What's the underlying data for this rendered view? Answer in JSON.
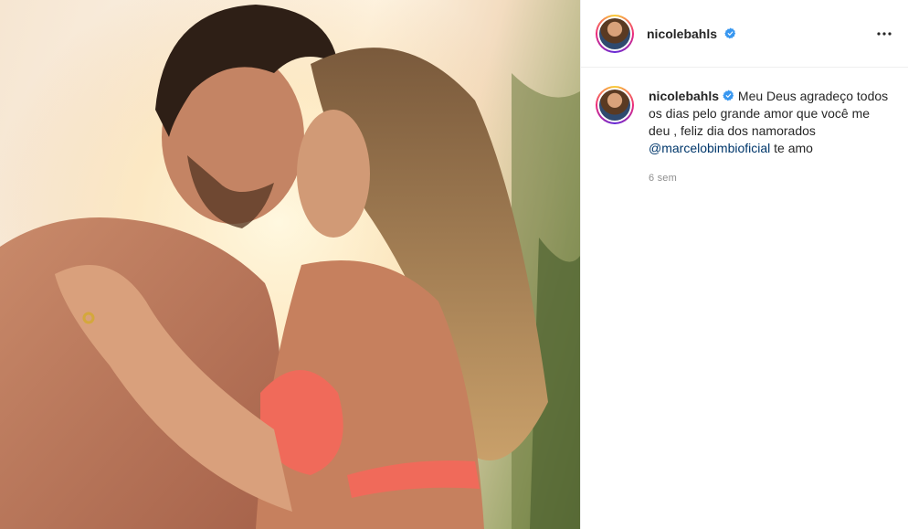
{
  "post": {
    "image_alt": "Couple embracing forehead to forehead at sunset",
    "author": {
      "username": "nicolebahls",
      "verified": true
    },
    "caption": {
      "text_before": "Meu Deus agradeço todos os dias pelo grande amor que você me deu , feliz dia dos namorados",
      "mention": "@marcelobimbioficial",
      "text_after": "te amo"
    },
    "timestamp": "6 sem"
  },
  "icons": {
    "more": "more-options-icon",
    "verified": "verified-badge-icon"
  },
  "colors": {
    "mention": "#00376b",
    "verified": "#3897f0",
    "muted": "#8e8e8e"
  }
}
